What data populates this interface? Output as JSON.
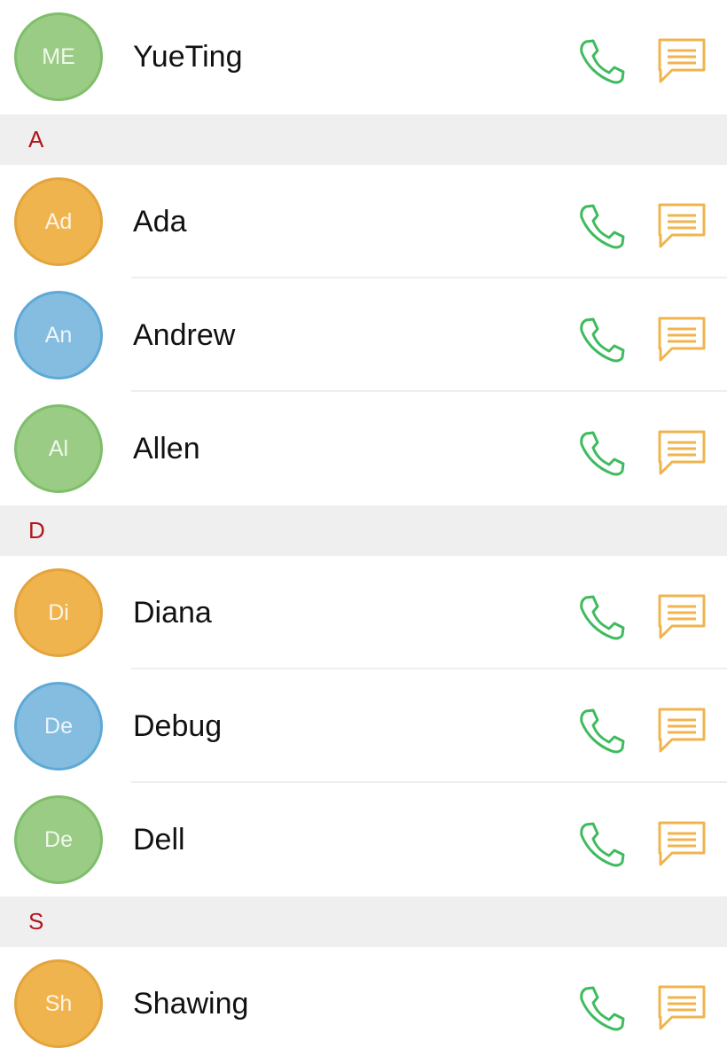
{
  "colors": {
    "green_fill": "#9acc86",
    "green_border": "#7fbe6b",
    "orange_fill": "#f0b44f",
    "orange_border": "#e3a43c",
    "blue_fill": "#84bde0",
    "blue_border": "#5fa9d6",
    "phone_icon": "#3fbb5f",
    "message_icon": "#f0b44f",
    "section_letter": "#b3141a",
    "section_bg": "#efefef"
  },
  "icons": {
    "call": "phone-icon",
    "message": "message-icon"
  },
  "me": {
    "initials": "ME",
    "name": "YueTing",
    "color": "green"
  },
  "sections": [
    {
      "letter": "A",
      "contacts": [
        {
          "initials": "Ad",
          "name": "Ada",
          "color": "orange"
        },
        {
          "initials": "An",
          "name": "Andrew",
          "color": "blue"
        },
        {
          "initials": "Al",
          "name": "Allen",
          "color": "green"
        }
      ]
    },
    {
      "letter": "D",
      "contacts": [
        {
          "initials": "Di",
          "name": "Diana",
          "color": "orange"
        },
        {
          "initials": "De",
          "name": "Debug",
          "color": "blue"
        },
        {
          "initials": "De",
          "name": "Dell",
          "color": "green"
        }
      ]
    },
    {
      "letter": "S",
      "contacts": [
        {
          "initials": "Sh",
          "name": "Shawing",
          "color": "orange"
        }
      ]
    }
  ]
}
